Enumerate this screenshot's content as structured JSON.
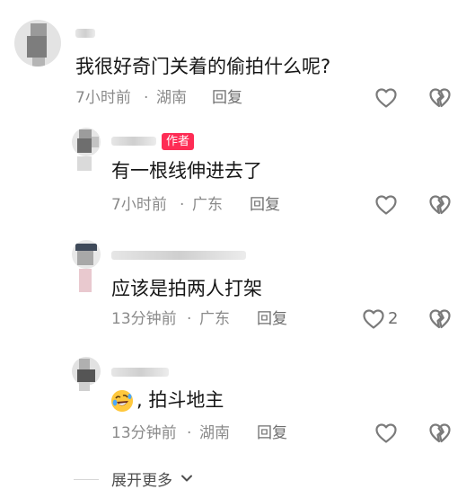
{
  "comments": [
    {
      "username": "",
      "text": "我很好奇门关着的偷拍什么呢?",
      "time": "7小时前",
      "separator": "·",
      "location": "湖南",
      "reply_label": "回复",
      "like_icon": "heart-outline-icon",
      "dislike_icon": "broken-heart-icon"
    },
    {
      "username": "",
      "author_badge": "作者",
      "text": "有一根线伸进去了",
      "time": "7小时前",
      "separator": "·",
      "location": "广东",
      "reply_label": "回复",
      "like_icon": "heart-outline-icon",
      "dislike_icon": "broken-heart-icon"
    },
    {
      "username": "",
      "text": "应该是拍两人打架",
      "time": "13分钟前",
      "separator": "·",
      "location": "广东",
      "reply_label": "回复",
      "like_count": "2",
      "like_icon": "heart-outline-icon",
      "dislike_icon": "broken-heart-icon"
    },
    {
      "username": "",
      "emoji": "rolling-on-floor-laughing-emoji",
      "text": ", 拍斗地主",
      "time": "13分钟前",
      "separator": "·",
      "location": "湖南",
      "reply_label": "回复",
      "like_icon": "heart-outline-icon",
      "dislike_icon": "broken-heart-icon"
    }
  ],
  "expand_more": "展开更多",
  "colors": {
    "author_badge": "#fe2c55",
    "text": "#161616",
    "meta": "#8a8a8a"
  }
}
